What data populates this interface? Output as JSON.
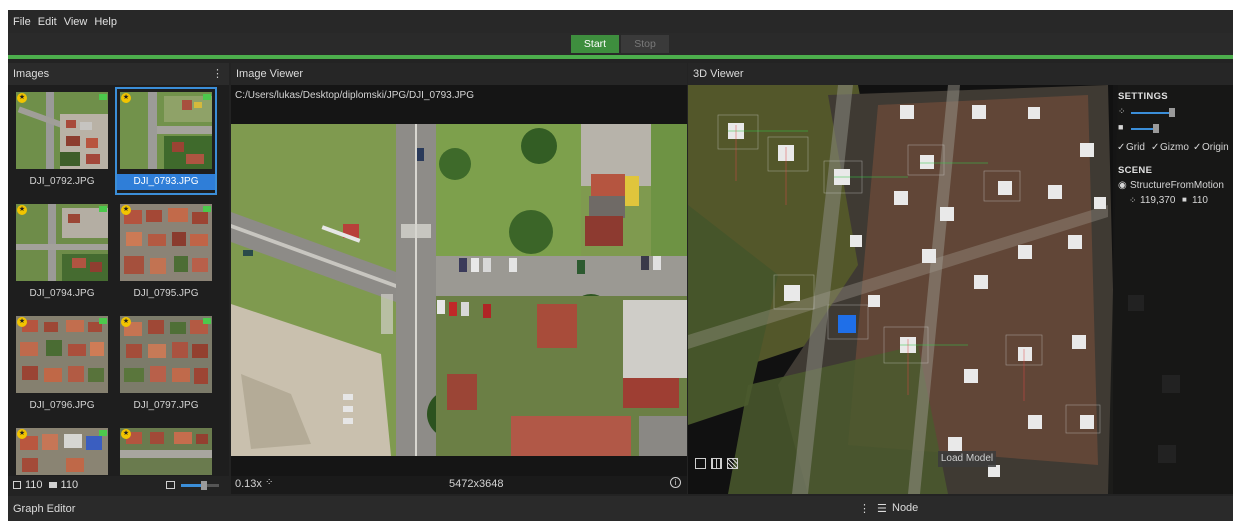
{
  "menu": {
    "items": [
      "File",
      "Edit",
      "View",
      "Help"
    ]
  },
  "toolbar": {
    "start_label": "Start",
    "stop_label": "Stop"
  },
  "images_panel": {
    "title": "Images",
    "thumbnails": [
      {
        "label": "DJI_0792.JPG",
        "selected": false
      },
      {
        "label": "DJI_0793.JPG",
        "selected": true
      },
      {
        "label": "DJI_0794.JPG",
        "selected": false
      },
      {
        "label": "DJI_0795.JPG",
        "selected": false
      },
      {
        "label": "DJI_0796.JPG",
        "selected": false
      },
      {
        "label": "DJI_0797.JPG",
        "selected": false
      },
      {
        "label": "",
        "selected": false
      },
      {
        "label": "",
        "selected": false
      }
    ],
    "footer": {
      "images_count": "110",
      "cameras_count": "110"
    }
  },
  "image_viewer": {
    "title": "Image Viewer",
    "path": "C:/Users/lukas/Desktop/diplomski/JPG/DJI_0793.JPG",
    "zoom": "0.13x",
    "resolution": "5472x3648"
  },
  "viewer_3d": {
    "title": "3D Viewer",
    "settings_heading": "SETTINGS",
    "grid_label": "Grid",
    "gizmo_label": "Gizmo",
    "origin_label": "Origin",
    "scene_heading": "SCENE",
    "scene_node": "StructureFromMotion",
    "points_count": "119,370",
    "cameras_count": "110",
    "load_model_label": "Load Model"
  },
  "graph_editor": {
    "title": "Graph Editor",
    "node_label": "Node"
  },
  "colors": {
    "accent_green": "#4cae4c",
    "selection_blue": "#2f7ed8"
  }
}
